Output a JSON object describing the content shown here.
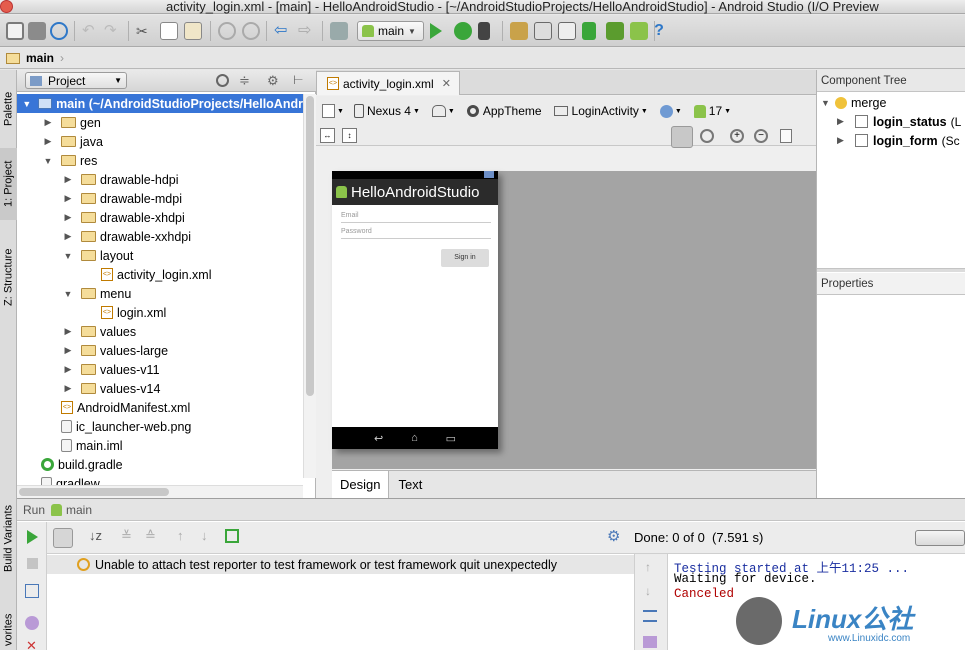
{
  "window": {
    "title": "activity_login.xml - [main] - HelloAndroidStudio - [~/AndroidStudioProjects/HelloAndroidStudio] - Android Studio (I/O Preview"
  },
  "toolbar": {
    "run_config": "main"
  },
  "navbar": {
    "crumb": "main"
  },
  "left_strip": {
    "tabs": [
      "Palette",
      "1: Project",
      "Z: Structure",
      "Build Variants",
      "vorites"
    ]
  },
  "project": {
    "header": "Project",
    "items": [
      {
        "label": "main (~/AndroidStudioProjects/HelloAndr",
        "depth": 0,
        "arrow": "▼",
        "kind": "module",
        "selected": true
      },
      {
        "label": "gen",
        "depth": 1,
        "arrow": "▶",
        "kind": "folder"
      },
      {
        "label": "java",
        "depth": 1,
        "arrow": "▶",
        "kind": "folder"
      },
      {
        "label": "res",
        "depth": 1,
        "arrow": "▼",
        "kind": "folder"
      },
      {
        "label": "drawable-hdpi",
        "depth": 2,
        "arrow": "▶",
        "kind": "folder"
      },
      {
        "label": "drawable-mdpi",
        "depth": 2,
        "arrow": "▶",
        "kind": "folder"
      },
      {
        "label": "drawable-xhdpi",
        "depth": 2,
        "arrow": "▶",
        "kind": "folder"
      },
      {
        "label": "drawable-xxhdpi",
        "depth": 2,
        "arrow": "▶",
        "kind": "folder"
      },
      {
        "label": "layout",
        "depth": 2,
        "arrow": "▼",
        "kind": "folder"
      },
      {
        "label": "activity_login.xml",
        "depth": 3,
        "arrow": "",
        "kind": "xml"
      },
      {
        "label": "menu",
        "depth": 2,
        "arrow": "▼",
        "kind": "folder"
      },
      {
        "label": "login.xml",
        "depth": 3,
        "arrow": "",
        "kind": "xml"
      },
      {
        "label": "values",
        "depth": 2,
        "arrow": "▶",
        "kind": "folder"
      },
      {
        "label": "values-large",
        "depth": 2,
        "arrow": "▶",
        "kind": "folder"
      },
      {
        "label": "values-v11",
        "depth": 2,
        "arrow": "▶",
        "kind": "folder"
      },
      {
        "label": "values-v14",
        "depth": 2,
        "arrow": "▶",
        "kind": "folder"
      },
      {
        "label": "AndroidManifest.xml",
        "depth": 1,
        "arrow": "",
        "kind": "xml"
      },
      {
        "label": "ic_launcher-web.png",
        "depth": 1,
        "arrow": "",
        "kind": "file"
      },
      {
        "label": "main.iml",
        "depth": 1,
        "arrow": "",
        "kind": "file"
      },
      {
        "label": "build.gradle",
        "depth": 0,
        "arrow": "",
        "kind": "gradle"
      },
      {
        "label": "gradlew",
        "depth": 0,
        "arrow": "",
        "kind": "file"
      }
    ]
  },
  "editor": {
    "tab_label": "activity_login.xml",
    "device": "Nexus 4",
    "theme": "AppTheme",
    "activity": "LoginActivity",
    "api": "17",
    "design_tab": "Design",
    "text_tab": "Text"
  },
  "phone": {
    "app_title": "HelloAndroidStudio",
    "email_hint": "Email",
    "password_hint": "Password",
    "signin_label": "Sign in"
  },
  "component_tree": {
    "header": "Component Tree",
    "root": "merge",
    "children": [
      {
        "label": "login_status",
        "suffix": "(L"
      },
      {
        "label": "login_form",
        "suffix": "(Sc"
      }
    ]
  },
  "properties": {
    "header": "Properties"
  },
  "run": {
    "header_prefix": "Run",
    "config": "main",
    "done_status": "Done: 0 of 0  (7.591 s)",
    "message": "Unable to attach test reporter to test framework or test framework quit unexpectedly",
    "console_lines": [
      "Testing started at 上午11:25 ...",
      "Waiting for device.",
      "Canceled"
    ]
  },
  "watermark": {
    "text": "Linux公社",
    "url": "www.Linuxidc.com"
  },
  "colors": {
    "selection": "#3875d7",
    "run_green": "#3aa63a",
    "android_green": "#8bc34a",
    "console_blue": "#1b2fa0",
    "console_red": "#b00000"
  }
}
